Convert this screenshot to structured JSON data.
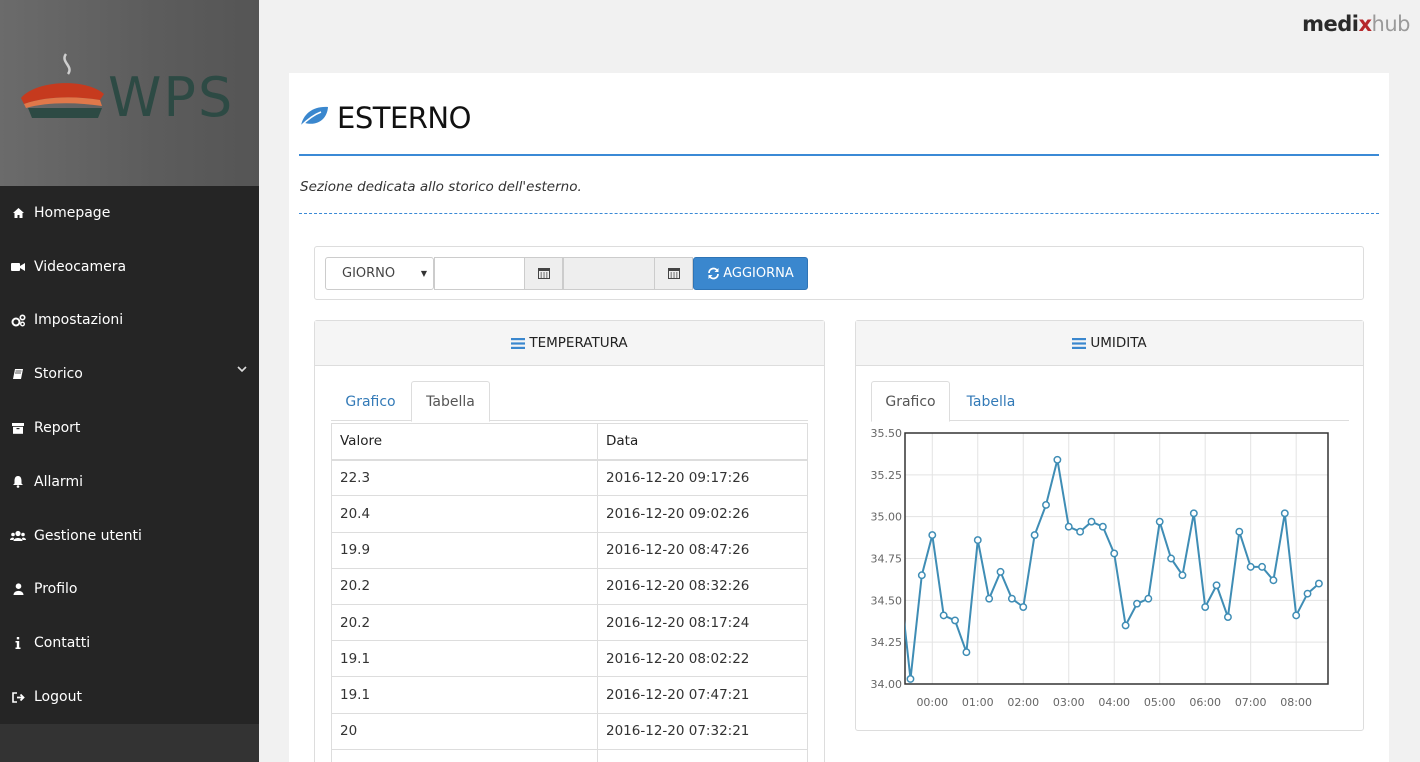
{
  "brand": {
    "part1": "medi",
    "part2": "x",
    "part3": "hub"
  },
  "logo": {
    "text": "WPS"
  },
  "sidebar": {
    "items": [
      {
        "label": "Homepage",
        "icon": "home-icon"
      },
      {
        "label": "Videocamera",
        "icon": "video-camera-icon"
      },
      {
        "label": "Impostazioni",
        "icon": "cogs-icon"
      },
      {
        "label": "Storico",
        "icon": "book-icon",
        "has_submenu": true
      },
      {
        "label": "Report",
        "icon": "archive-icon"
      },
      {
        "label": "Allarmi",
        "icon": "bell-icon"
      },
      {
        "label": "Gestione utenti",
        "icon": "users-icon"
      },
      {
        "label": "Profilo",
        "icon": "user-icon"
      },
      {
        "label": "Contatti",
        "icon": "info-icon"
      },
      {
        "label": "Logout",
        "icon": "sign-out-icon"
      }
    ]
  },
  "page": {
    "title": "ESTERNO",
    "subtitle": "Sezione dedicata allo storico dell'esterno."
  },
  "filter": {
    "period_selected": "GIORNO",
    "start_date": "",
    "end_date": "",
    "refresh_label": "AGGIORNA"
  },
  "temperature_panel": {
    "title": "TEMPERATURA",
    "tabs": [
      {
        "label": "Grafico",
        "active": false
      },
      {
        "label": "Tabella",
        "active": true
      }
    ],
    "table": {
      "columns": [
        "Valore",
        "Data"
      ],
      "rows": [
        [
          "22.3",
          "2016-12-20 09:17:26"
        ],
        [
          "20.4",
          "2016-12-20 09:02:26"
        ],
        [
          "19.9",
          "2016-12-20 08:47:26"
        ],
        [
          "20.2",
          "2016-12-20 08:32:26"
        ],
        [
          "20.2",
          "2016-12-20 08:17:24"
        ],
        [
          "19.1",
          "2016-12-20 08:02:22"
        ],
        [
          "19.1",
          "2016-12-20 07:47:21"
        ],
        [
          "20",
          "2016-12-20 07:32:21"
        ]
      ]
    }
  },
  "humidity_panel": {
    "title": "UMIDITA",
    "tabs": [
      {
        "label": "Grafico",
        "active": true
      },
      {
        "label": "Tabella",
        "active": false
      }
    ]
  },
  "colors": {
    "accent": "#3b8ad6",
    "button": "#3a87ce",
    "line": "#3f8db5",
    "sidebar": "#252525"
  },
  "chart_data": {
    "type": "line",
    "title": "",
    "xlabel": "",
    "ylabel": "",
    "xlim": [
      -0.6,
      8.7
    ],
    "ylim": [
      34.0,
      35.5
    ],
    "y_ticks": [
      "34.00",
      "34.25",
      "34.50",
      "34.75",
      "35.00",
      "35.25",
      "35.50"
    ],
    "x_tick_values": [
      0,
      1,
      2,
      3,
      4,
      5,
      6,
      7,
      8
    ],
    "x_tick_labels": [
      "00:00",
      "01:00",
      "02:00",
      "03:00",
      "04:00",
      "05:00",
      "06:00",
      "07:00",
      "08:00"
    ],
    "grid": true,
    "series": [
      {
        "x": [
          -0.98,
          -0.73,
          -0.48,
          -0.23,
          0.0,
          0.25,
          0.5,
          0.75,
          1.0,
          1.25,
          1.5,
          1.75,
          2.0,
          2.25,
          2.5,
          2.75,
          3.0,
          3.25,
          3.5,
          3.75,
          4.0,
          4.25,
          4.5,
          4.75,
          5.0,
          5.25,
          5.5,
          5.75,
          6.0,
          6.25,
          6.5,
          6.75,
          7.0,
          7.25,
          7.5,
          7.75,
          8.0,
          8.25,
          8.5
        ],
        "values": [
          34.89,
          34.65,
          34.03,
          34.65,
          34.89,
          34.41,
          34.38,
          34.19,
          34.86,
          34.51,
          34.67,
          34.51,
          34.46,
          34.89,
          35.07,
          35.34,
          34.94,
          34.91,
          34.97,
          34.94,
          34.78,
          34.35,
          34.48,
          34.51,
          34.97,
          34.75,
          34.65,
          35.02,
          34.46,
          34.59,
          34.4,
          34.91,
          34.7,
          34.7,
          34.62,
          35.02,
          34.41,
          34.54,
          34.6
        ]
      }
    ]
  }
}
